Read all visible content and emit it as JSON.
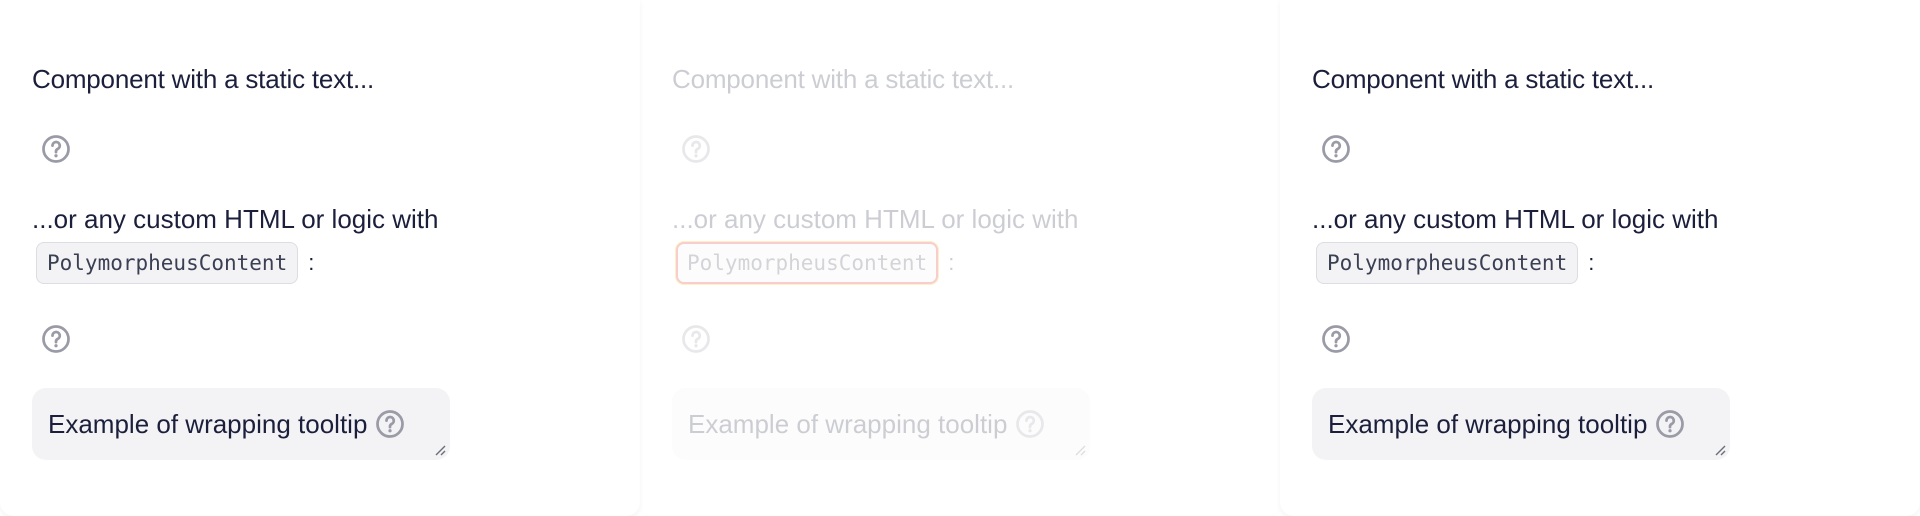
{
  "colors": {
    "text": "#1b1f3b",
    "icon": "#9a9ba6",
    "chip_bg": "#f3f3f5",
    "focus_ring": "#e01f1f"
  },
  "panels": [
    {
      "state": "normal",
      "static_text": "Component with a static text...",
      "custom_text": "...or any custom HTML or logic with",
      "code_chip": "PolymorpheusContent",
      "colon": ":",
      "textarea_value": "Example of wrapping tooltip",
      "icons": [
        "question-circle-icon",
        "question-circle-icon",
        "question-circle-icon"
      ]
    },
    {
      "state": "disabled",
      "static_text": "Component with a static text...",
      "custom_text": "...or any custom HTML or logic with",
      "code_chip": "PolymorpheusContent",
      "colon": ":",
      "textarea_value": "Example of wrapping tooltip",
      "icons": [
        "question-circle-icon",
        "question-circle-icon",
        "question-circle-icon"
      ]
    },
    {
      "state": "normal",
      "static_text": "Component with a static text...",
      "custom_text": "...or any custom HTML or logic with",
      "code_chip": "PolymorpheusContent",
      "colon": ":",
      "textarea_value": "Example of wrapping tooltip",
      "icons": [
        "question-circle-icon",
        "question-circle-icon",
        "question-circle-icon"
      ]
    }
  ]
}
